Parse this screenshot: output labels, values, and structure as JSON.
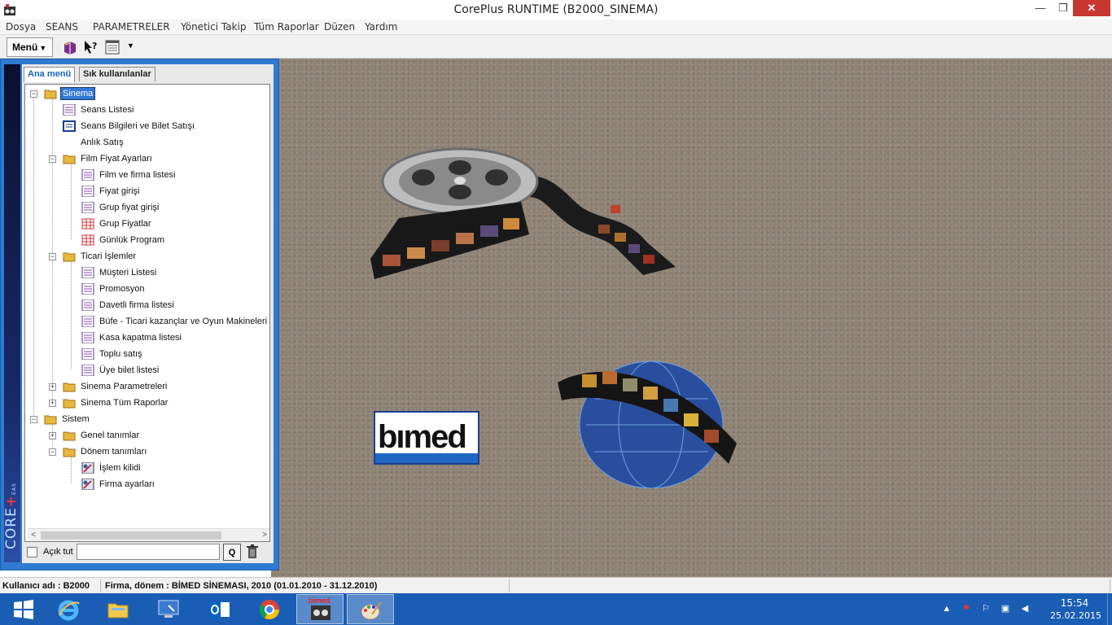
{
  "window": {
    "title": "CorePlus RUNTIME (B2000_SINEMA)",
    "min_glyph": "—",
    "max_glyph": "❐",
    "close_glyph": "✕"
  },
  "menubar": {
    "items": [
      "Dosya",
      "SEANS",
      "PARAMETRELER",
      "Yönetici Takip",
      "Tüm Raporlar",
      "Düzen",
      "Yardım"
    ]
  },
  "toolbar": {
    "menu_label": "Menü",
    "menu_arrow": "▼",
    "icons": [
      "book-icon",
      "help-pointer-icon",
      "list-window-icon"
    ],
    "overflow_arrow": "▼"
  },
  "sidepanel": {
    "brand": "CORE",
    "brand_plus": "+",
    "brand_sub": "EAS",
    "tabs": {
      "main": "Ana menü",
      "frequent": "Sık kullanılanlar"
    },
    "tree": {
      "root": "Sinema",
      "seans_listesi": "Seans Listesi",
      "seans_bilgileri": "Seans Bilgileri ve Bilet Satışı",
      "anlik_satis": "Anlık Satış",
      "film_fiyat": "Film Fiyat Ayarları",
      "film_firma": "Film ve firma listesi",
      "fiyat_girisi": "Fiyat girişi",
      "grup_fiyat_girisi": "Grup fiyat girişi",
      "grup_fiyatlar": "Grup Fiyatlar",
      "gunluk_program": "Günlük Program",
      "ticari": "Ticari İşlemler",
      "musteri": "Müşteri Listesi",
      "promosyon": "Promosyon",
      "davetli": "Davetli firma listesi",
      "bufe": "Büfe - Ticari kazançlar ve Oyun Makineleri Kasası",
      "kasa": "Kasa kapatma listesi",
      "toplu": "Toplu satış",
      "uye": "Üye bilet listesi",
      "sinema_param": "Sinema Parametreleri",
      "sinema_raporlar": "Sinema Tüm Raporlar",
      "sistem": "Sistem",
      "genel": "Genel tanımlar",
      "donem": "Dönem tanımları",
      "islem_kilidi": "İşlem kilidi",
      "firma_ayarlari": "Firma ayarları"
    },
    "keep_open_label": "Açık tut",
    "quick_search_value": "",
    "quick_go_label": "Q"
  },
  "desktop": {
    "logo_text": "bımed"
  },
  "statusbar": {
    "user": "Kullanıcı adı : B2000",
    "firm": "Firma, dönem : BİMED SİNEMASI, 2010 (01.01.2010 - 31.12.2010)"
  },
  "taskbar": {
    "apps": [
      "windows-start-icon",
      "internet-explorer-icon",
      "file-explorer-icon",
      "remote-desktop-icon",
      "outlook-icon",
      "chrome-icon",
      "bimed-app-icon",
      "paint-icon"
    ],
    "active_app_label": "bimed",
    "time": "15:54",
    "date": "25.02.2015"
  },
  "colors": {
    "panel_blue": "#2d7bd2",
    "taskbar_blue": "#1a5db5",
    "close_red": "#c7372f",
    "selection": "#3178d8",
    "folder": "#f0c040"
  }
}
